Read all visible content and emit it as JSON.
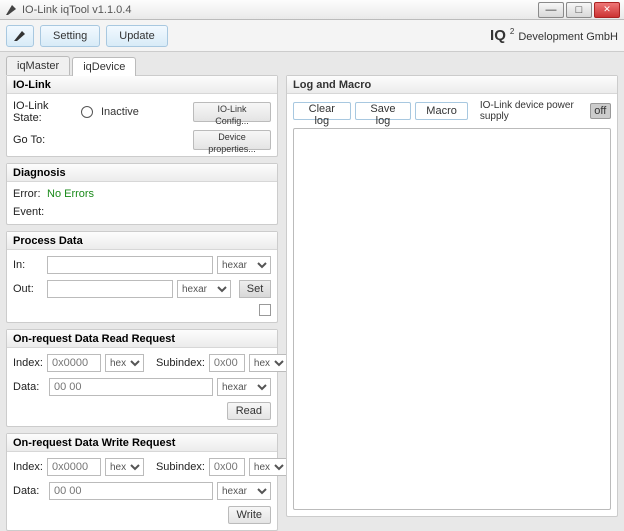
{
  "window": {
    "title": "IO-Link iqTool v1.1.0.4",
    "min": "—",
    "max": "□"
  },
  "toolbar": {
    "setting": "Setting",
    "update": "Update"
  },
  "brand": {
    "iq": "IQ",
    "sq": "2",
    "rest": "Development GmbH"
  },
  "tabs": {
    "master": "iqMaster",
    "device": "iqDevice"
  },
  "iolink": {
    "header": "IO-Link",
    "state_lbl": "IO-Link State:",
    "state_val": "Inactive",
    "btn_config": "IO-Link Config...",
    "goto_lbl": "Go To:",
    "btn_props": "Device properties..."
  },
  "diag": {
    "header": "Diagnosis",
    "error_lbl": "Error:",
    "error_val": "No Errors",
    "event_lbl": "Event:"
  },
  "pdata": {
    "header": "Process Data",
    "in_lbl": "In:",
    "out_lbl": "Out:",
    "unit_opt": "hexar",
    "set_btn": "Set"
  },
  "read": {
    "header": "On-request Data Read Request",
    "index_lbl": "Index:",
    "index_ph": "0x0000",
    "fmt_opt": "hex",
    "sub_lbl": "Subindex:",
    "sub_ph": "0x00",
    "data_lbl": "Data:",
    "data_ph": "00 00",
    "unit_opt": "hexar",
    "btn": "Read"
  },
  "write": {
    "header": "On-request Data Write Request",
    "index_lbl": "Index:",
    "index_ph": "0x0000",
    "fmt_opt": "hex",
    "sub_lbl": "Subindex:",
    "sub_ph": "0x00",
    "data_lbl": "Data:",
    "data_ph": "00 00",
    "unit_opt": "hexar",
    "btn": "Write"
  },
  "log": {
    "header": "Log and Macro",
    "clear": "Clear log",
    "save": "Save log",
    "macro": "Macro",
    "psupply": "IO-Link device power supply",
    "toggle": "off"
  }
}
